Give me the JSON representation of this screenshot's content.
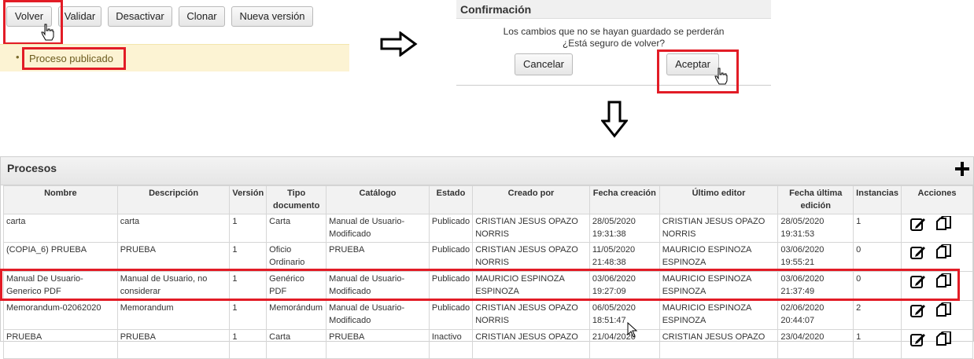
{
  "toolbar": {
    "volver": "Volver",
    "validar": "Validar",
    "desactivar": "Desactivar",
    "clonar": "Clonar",
    "nueva_version": "Nueva versión"
  },
  "notice": {
    "text": "Proceso publicado"
  },
  "dialog": {
    "title": "Confirmación",
    "line1": "Los cambios que no se hayan guardado se perderán",
    "line2": "¿Está seguro de volver?",
    "cancel": "Cancelar",
    "accept": "Aceptar"
  },
  "panel": {
    "title": "Procesos",
    "add_icon": "plus-icon",
    "columns": [
      "Nombre",
      "Descripción",
      "Versión",
      "Tipo documento",
      "Catálogo",
      "Estado",
      "Creado por",
      "Fecha creación",
      "Último editor",
      "Fecha última edición",
      "Instancias",
      "Acciones"
    ],
    "rows": [
      [
        "carta",
        "carta",
        "1",
        "Carta",
        "Manual de Usuario-Modificado",
        "Publicado",
        "CRISTIAN JESUS OPAZO NORRIS",
        "28/05/2020 19:31:38",
        "CRISTIAN JESUS OPAZO NORRIS",
        "28/05/2020 19:31:53",
        "1"
      ],
      [
        "(COPIA_6) PRUEBA",
        "PRUEBA",
        "1",
        "Oficio Ordinario",
        "PRUEBA",
        "Publicado",
        "CRISTIAN JESUS OPAZO NORRIS",
        "11/05/2020 21:48:38",
        "MAURICIO ESPINOZA ESPINOZA",
        "03/06/2020 19:55:21",
        "0"
      ],
      [
        "Manual De Usuario-Generico PDF",
        "Manual de Usuario, no considerar",
        "1",
        "Genérico PDF",
        "Manual de Usuario-Modificado",
        "Publicado",
        "MAURICIO ESPINOZA ESPINOZA",
        "03/06/2020 19:27:09",
        "MAURICIO ESPINOZA ESPINOZA",
        "03/06/2020 21:37:49",
        "0"
      ],
      [
        "Memorandum-02062020",
        "Memorandum",
        "1",
        "Memorándum",
        "Manual de Usuario-Modificado",
        "Publicado",
        "CRISTIAN JESUS OPAZO NORRIS",
        "06/05/2020 18:51:47",
        "MAURICIO ESPINOZA ESPINOZA",
        "02/06/2020 20:44:07",
        "2"
      ],
      [
        "PRUEBA",
        "PRUEBA",
        "1",
        "Carta",
        "PRUEBA",
        "Inactivo",
        "CRISTIAN JESUS OPAZO",
        "21/04/2020",
        "CRISTIAN JESUS OPAZO",
        "23/04/2020",
        "1"
      ]
    ],
    "action_icons": [
      "edit-icon",
      "clone-icon"
    ]
  },
  "colors": {
    "highlight": "#e21c26",
    "notice_bg": "#fcf3d3"
  }
}
